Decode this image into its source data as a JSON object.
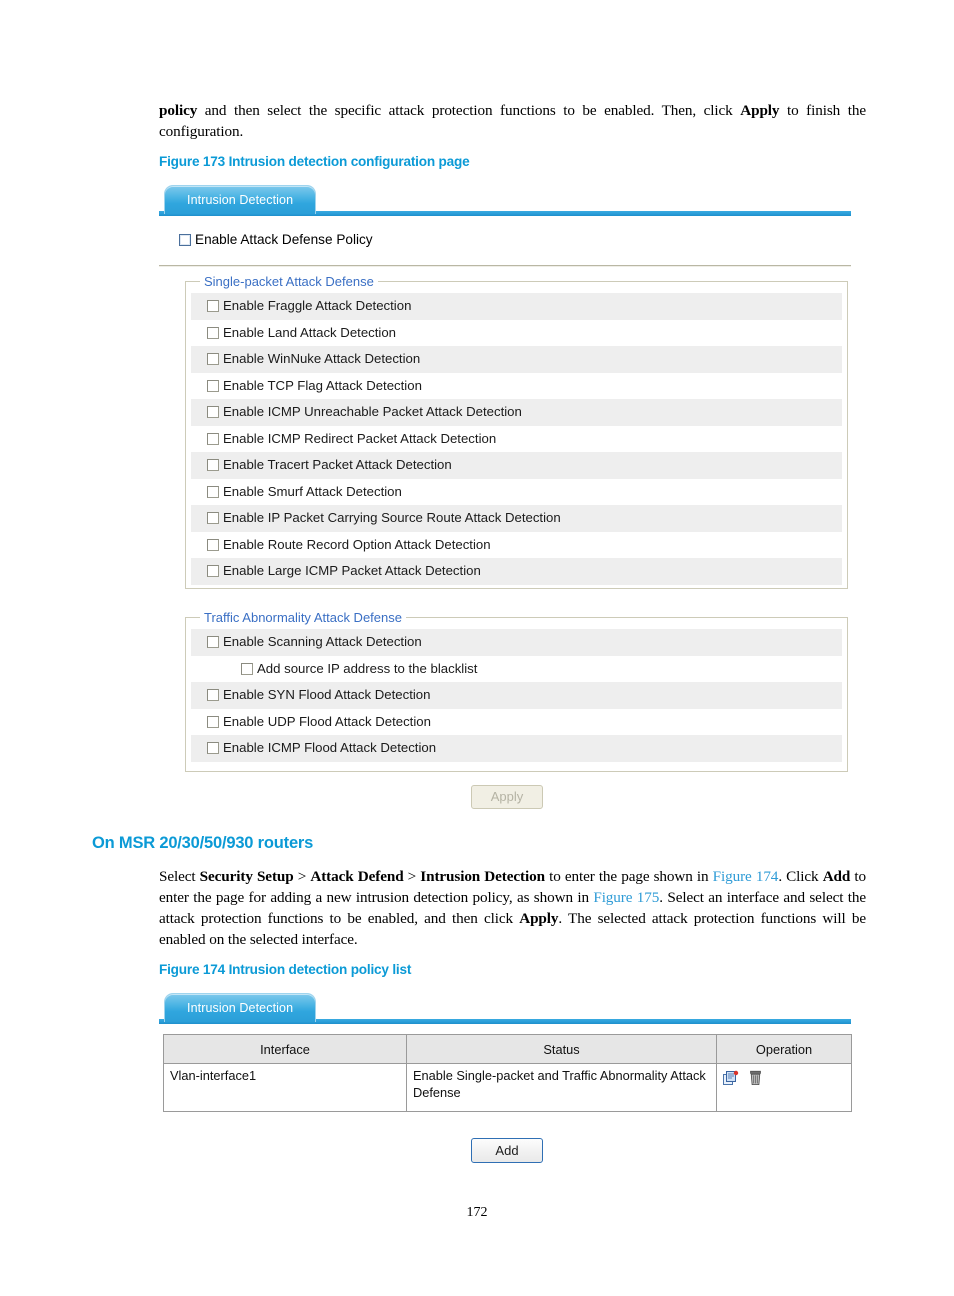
{
  "document": {
    "page_number": "172",
    "intro_paragraph_prefix": "policy",
    "intro_paragraph_mid": " and then select the specific attack protection functions to be enabled. Then, click ",
    "intro_paragraph_apply": "Apply",
    "intro_paragraph_suffix": " to finish the configuration.",
    "figure_173_caption": "Figure 173 Intrusion detection configuration page",
    "figure_174_caption": "Figure 174 Intrusion detection policy list",
    "section_heading": "On MSR 20/30/50/930 routers",
    "msr_paragraph": {
      "t1": "Select ",
      "b1": "Security Setup",
      "t2": " > ",
      "b2": "Attack Defend",
      "t3": " > ",
      "b3": "Intrusion Detection",
      "t4": " to enter the page shown in ",
      "x1": "Figure 174",
      "t5": ". Click ",
      "b4": "Add",
      "t6": " to enter the page for adding a new intrusion detection policy, as shown in ",
      "x2": "Figure 175",
      "t7": ". Select an interface and select the attack protection functions to be enabled, and then click ",
      "b5": "Apply",
      "t8": ". The selected attack protection functions will be enabled on the selected interface."
    }
  },
  "figure173": {
    "tab_label": "Intrusion Detection",
    "master_checkbox_label": "Enable Attack Defense Policy",
    "master_checkbox_checked": false,
    "single_packet": {
      "legend": "Single-packet Attack Defense",
      "items": [
        "Enable Fraggle Attack Detection",
        "Enable Land Attack Detection",
        "Enable WinNuke Attack Detection",
        "Enable TCP Flag Attack Detection",
        "Enable ICMP Unreachable Packet Attack Detection",
        "Enable ICMP Redirect Packet Attack Detection",
        "Enable Tracert Packet Attack Detection",
        "Enable Smurf Attack Detection",
        "Enable IP Packet Carrying Source Route Attack Detection",
        "Enable Route Record Option Attack Detection",
        "Enable Large ICMP Packet Attack Detection"
      ]
    },
    "traffic_abnormality": {
      "legend": "Traffic Abnormality Attack Defense",
      "items": [
        {
          "label": "Enable Scanning Attack Detection",
          "indent": false
        },
        {
          "label": "Add source IP address to the blacklist",
          "indent": true
        },
        {
          "label": "Enable SYN Flood Attack Detection",
          "indent": false
        },
        {
          "label": "Enable UDP Flood Attack Detection",
          "indent": false
        },
        {
          "label": "Enable ICMP Flood Attack Detection",
          "indent": false
        }
      ]
    },
    "apply_button": "Apply"
  },
  "figure174": {
    "tab_label": "Intrusion Detection",
    "table": {
      "columns": [
        "Interface",
        "Status",
        "Operation"
      ],
      "rows": [
        {
          "interface": "Vlan-interface1",
          "status": "Enable Single-packet and Traffic Abnormality Attack Defense",
          "operation_icons": [
            "edit-icon",
            "delete-icon"
          ]
        }
      ]
    },
    "add_button": "Add"
  },
  "colors": {
    "accent_blue": "#0b9ad6",
    "tab_blue": "#2b9fd8",
    "legend_blue": "#3a6fc4",
    "row_stripe": "#eeeeee",
    "table_header": "#e6e6e6"
  }
}
